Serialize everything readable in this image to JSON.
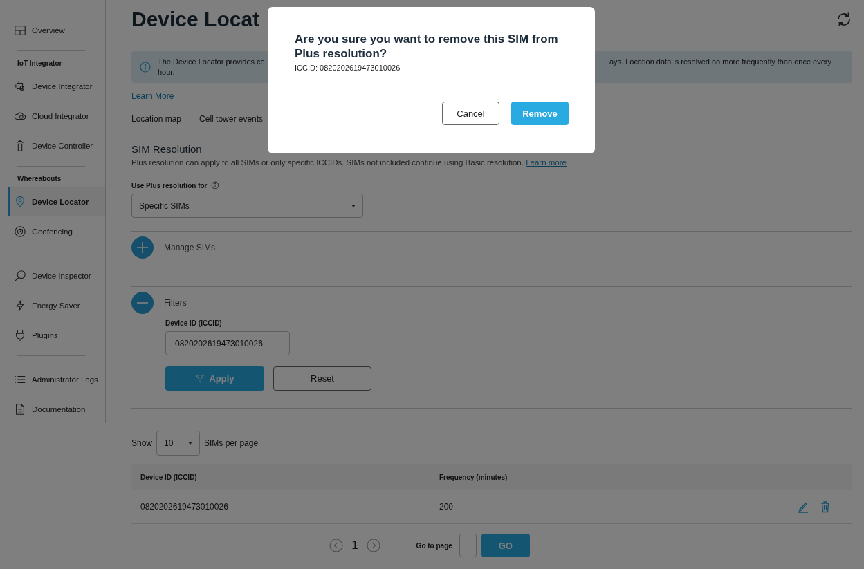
{
  "header": {
    "title": "Device Locat"
  },
  "sidebar": {
    "groups": [
      {
        "items": [
          {
            "label": "Overview",
            "selected": false
          }
        ]
      },
      {
        "heading": "IoT Integrator",
        "items": [
          {
            "label": "Device Integrator",
            "selected": false
          },
          {
            "label": "Cloud Integrator",
            "selected": false
          },
          {
            "label": "Device Controller",
            "selected": false
          }
        ]
      },
      {
        "heading": "Whereabouts",
        "items": [
          {
            "label": "Device Locator",
            "selected": true
          },
          {
            "label": "Geofencing",
            "selected": false
          }
        ]
      },
      {
        "items": [
          {
            "label": "Device Inspector",
            "selected": false
          },
          {
            "label": "Energy Saver",
            "selected": false
          },
          {
            "label": "Plugins",
            "selected": false
          }
        ]
      },
      {
        "items": [
          {
            "label": "Administrator Logs",
            "selected": false
          },
          {
            "label": "Documentation",
            "selected": false
          }
        ]
      }
    ]
  },
  "info_banner": {
    "text_start": "The Device Locator provides ce",
    "text_end": "ays. Location data is resolved no more frequently than once every",
    "text_wrap": "hour.",
    "link": "Learn More"
  },
  "tabs": [
    {
      "label": "Location map",
      "selected": false
    },
    {
      "label": "Cell tower events",
      "selected": false
    }
  ],
  "sim_resolution": {
    "title": "SIM Resolution",
    "description": "Plus resolution can apply to all SIMs or only specific ICCIDs. SIMs not included continue using Basic resolution.",
    "link": "Learn more",
    "select_label": "Use Plus resolution for",
    "select_value": "Specific SIMs"
  },
  "sections": [
    {
      "label": "Manage SIMs",
      "expanded": false
    },
    {
      "label": "Filters",
      "expanded": true
    }
  ],
  "filters": {
    "field_label": "Device ID (ICCID)",
    "field_value": "0820202619473010026",
    "apply": "Apply",
    "reset": "Reset"
  },
  "page_size": {
    "prefix": "Show",
    "value": "10",
    "suffix": "SIMs per page"
  },
  "table": {
    "columns": [
      "Device ID (ICCID)",
      "Frequency (minutes)"
    ],
    "rows": [
      {
        "cells": [
          "0820202619473010026",
          "200"
        ]
      }
    ]
  },
  "pagination": {
    "page": "1",
    "goto_label": "Go to page",
    "go": "GO"
  },
  "dialog": {
    "title": "Are you sure you want to remove this SIM from Plus resolution?",
    "detail": "ICCID: 0820202619473010026",
    "buttons": [
      {
        "label": "Cancel",
        "kind": "secondary"
      },
      {
        "label": "Remove",
        "kind": "primary"
      }
    ]
  }
}
